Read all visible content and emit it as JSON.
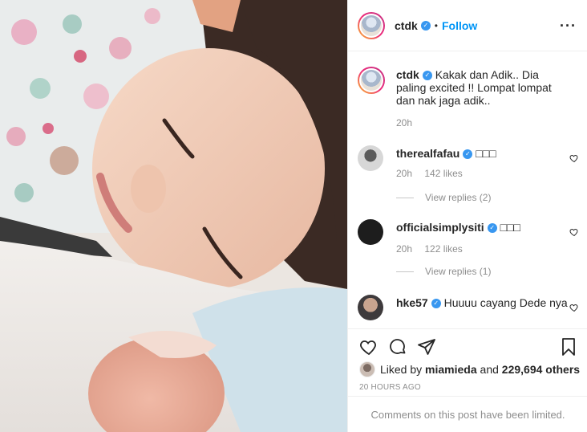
{
  "post": {
    "author": "ctdk",
    "follow_label": "Follow",
    "more_label": "•••",
    "dot": "•"
  },
  "caption": {
    "user": "ctdk",
    "text": "Kakak dan Adik.. Dia paling excited !! Lompat lompat dan nak jaga adik..",
    "time": "20h"
  },
  "comments": [
    {
      "user": "therealfafau",
      "text": "□□□",
      "time": "20h",
      "likes": "142 likes",
      "replies": "View replies (2)"
    },
    {
      "user": "officialsimplysiti",
      "text": "□□□",
      "time": "20h",
      "likes": "122 likes",
      "replies": "View replies (1)"
    },
    {
      "user": "hke57",
      "text": "Huuuu cayang Dede nya"
    }
  ],
  "likes_line": {
    "prefix": "Liked by ",
    "user": "miamieda",
    "middle": " and ",
    "count": "229,694 others"
  },
  "timestamp": "20 HOURS AGO",
  "comments_limited": "Comments on this post have been limited.",
  "icons": {
    "like": "heart-icon",
    "comment": "comment-bubble-icon",
    "share": "paper-plane-icon",
    "save": "bookmark-icon",
    "verified": "verified-badge-icon",
    "more": "ellipsis-icon"
  },
  "colors": {
    "link_blue": "#0095f6",
    "verified_blue": "#3897f0",
    "muted": "#8e8e8e",
    "text": "#262626"
  }
}
